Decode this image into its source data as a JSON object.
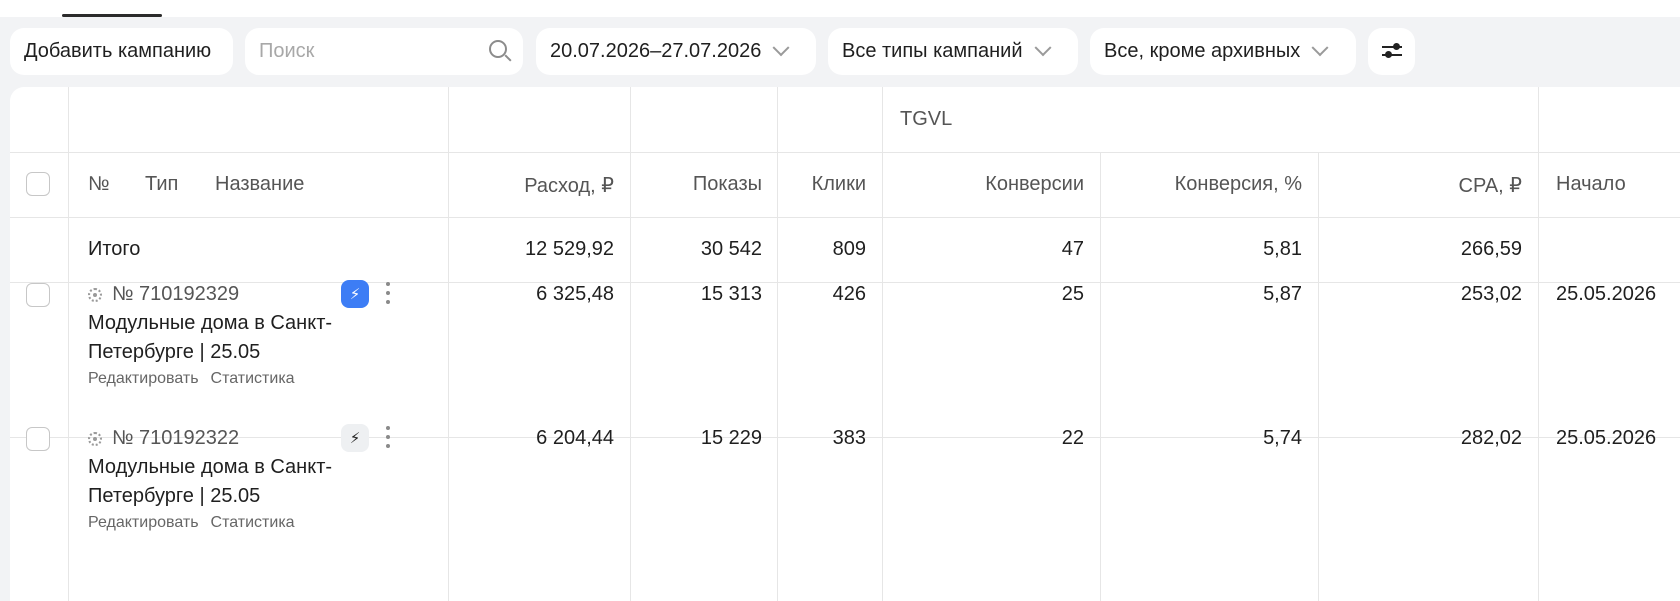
{
  "toolbar": {
    "add_campaign": "Добавить кампанию",
    "search_placeholder": "Поиск",
    "date_range": "20.07.2026–27.07.2026",
    "campaign_types": "Все типы кампаний",
    "status_filter": "Все, кроме архивных"
  },
  "table": {
    "group_header": "TGVL",
    "headers": {
      "number": "№",
      "type": "Тип",
      "name": "Название",
      "spend": "Расход, ₽",
      "impressions": "Показы",
      "clicks": "Клики",
      "conversions": "Конверсии",
      "conversion_rate": "Конверсия, %",
      "cpa": "CPA, ₽",
      "start": "Начало"
    },
    "total": {
      "label": "Итого",
      "spend": "12 529,92",
      "impressions": "30 542",
      "clicks": "809",
      "conversions": "47",
      "conversion_rate": "5,81",
      "cpa": "266,59"
    },
    "rows": [
      {
        "id": "№ 710192329",
        "name": "Модульные дома в Санкт-Петербурге | 25.05",
        "edit": "Редактировать",
        "stats": "Статистика",
        "spend": "6 325,48",
        "impressions": "15 313",
        "clicks": "426",
        "conversions": "25",
        "conversion_rate": "5,87",
        "cpa": "253,02",
        "start": "25.05.2026",
        "bolt": "blue"
      },
      {
        "id": "№ 710192322",
        "name": "Модульные дома в Санкт-Петербурге | 25.05",
        "edit": "Редактировать",
        "stats": "Статистика",
        "spend": "6 204,44",
        "impressions": "15 229",
        "clicks": "383",
        "conversions": "22",
        "conversion_rate": "5,74",
        "cpa": "282,02",
        "start": "25.05.2026",
        "bolt": "grey"
      }
    ]
  },
  "colors": {
    "accent": "#3d7df5",
    "background": "#f2f3f5"
  },
  "icons": [
    "search-icon",
    "chevron-down-icon",
    "filter-settings-icon",
    "bolt-icon",
    "more-vertical-icon",
    "campaign-status-icon"
  ]
}
